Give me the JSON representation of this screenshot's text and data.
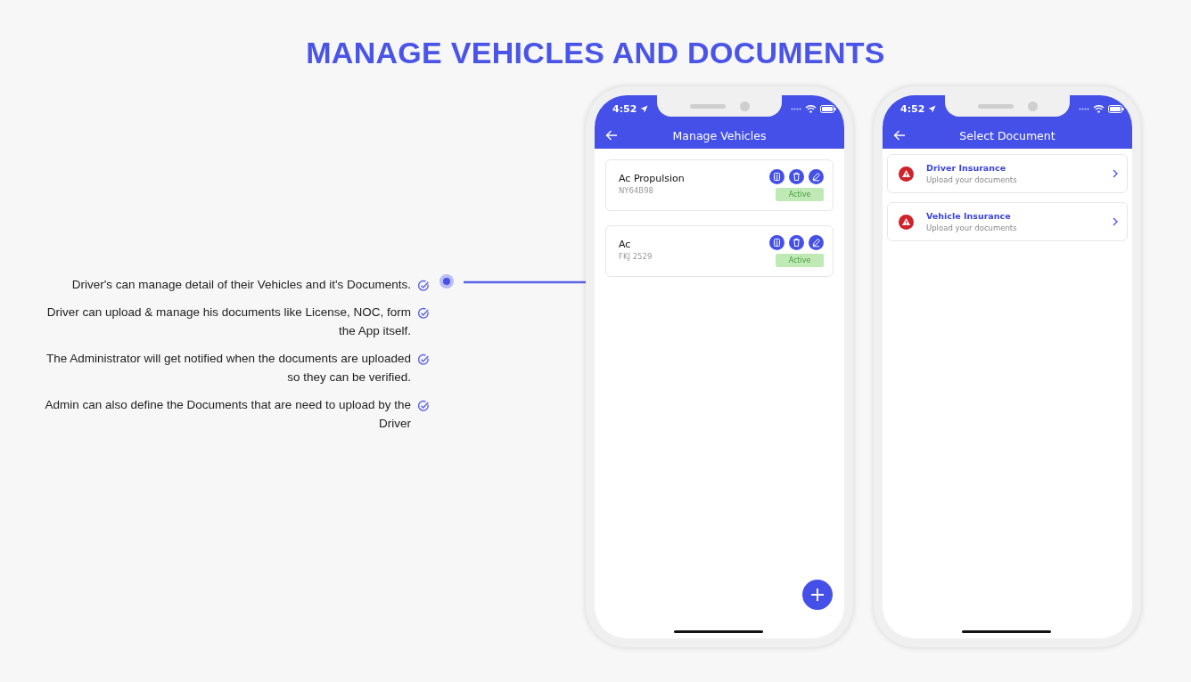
{
  "title": "MANAGE VEHICLES AND DOCUMENTS",
  "features": [
    {
      "text": "Driver's can manage detail of their Vehicles and it's Documents."
    },
    {
      "text": "Driver can upload & manage his documents like License, NOC, form the App itself."
    },
    {
      "text": "The Administrator will get notified when the documents are uploaded so they can be verified."
    },
    {
      "text": "Admin can also define the Documents that are need to upload by the Driver"
    }
  ],
  "phones": [
    {
      "kind": "vehicles",
      "time": "4:52",
      "title": "Manage Vehicles",
      "vehicles": [
        {
          "name": "Ac Propulsion",
          "plate": "NY64B98",
          "status": "Active"
        },
        {
          "name": "Ac",
          "plate": "FKJ 2529",
          "status": "Active"
        }
      ]
    },
    {
      "kind": "documents",
      "time": "4:52",
      "title": "Select Document",
      "documents": [
        {
          "name": "Driver Insurance",
          "hint": "Upload your documents"
        },
        {
          "name": "Vehicle Insurance",
          "hint": "Upload your documents"
        }
      ]
    }
  ]
}
